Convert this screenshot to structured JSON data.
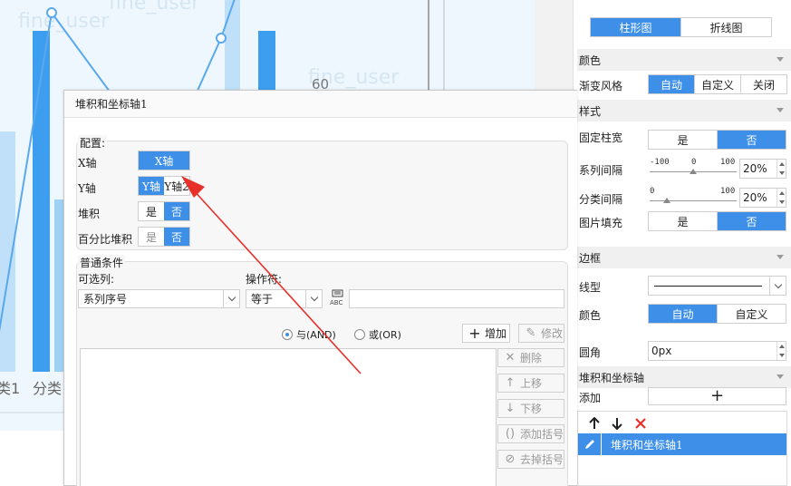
{
  "background_chart": {
    "watermark_texts": [
      "fine_user",
      "fine_user",
      "fine_user"
    ],
    "category_labels": [
      "类1",
      "分类"
    ],
    "axis_tick_label": "60",
    "colors": {
      "bar": "#3d9ef0",
      "bar_light": "#bfe0f8",
      "line": "#5aa8ee",
      "background": "#eef7fd"
    }
  },
  "panel": {
    "chart_type_tabs": [
      {
        "label": "柱形图",
        "active": true
      },
      {
        "label": "折线图",
        "active": false
      }
    ],
    "sections": {
      "color": {
        "title": "颜色"
      },
      "style": {
        "title": "样式"
      },
      "border": {
        "title": "边框"
      },
      "stack": {
        "title": "堆积和坐标轴"
      }
    },
    "gradient_style": {
      "label": "渐变风格",
      "options": [
        {
          "label": "自动",
          "active": true
        },
        {
          "label": "自定义",
          "active": false
        },
        {
          "label": "关闭",
          "active": false
        }
      ]
    },
    "fixed_width": {
      "label": "固定柱宽",
      "options": [
        {
          "label": "是",
          "active": false
        },
        {
          "label": "否",
          "active": true
        }
      ]
    },
    "series_gap": {
      "label": "系列间隔",
      "min": "-100",
      "mid": "0",
      "max": "100",
      "value": "20%",
      "fraction": 0.5
    },
    "category_gap": {
      "label": "分类间隔",
      "min": "0",
      "max": "100",
      "value": "20%",
      "fraction": 0.2
    },
    "image_fill": {
      "label": "图片填充",
      "options": [
        {
          "label": "是",
          "active": false
        },
        {
          "label": "否",
          "active": true
        }
      ]
    },
    "line_type": {
      "label": "线型"
    },
    "border_color": {
      "label": "颜色",
      "options": [
        {
          "label": "自动",
          "active": true
        },
        {
          "label": "自定义",
          "active": false
        }
      ]
    },
    "corner_radius": {
      "label": "圆角",
      "value": "0px"
    },
    "add": {
      "label": "添加",
      "symbol": "+"
    },
    "list_items": [
      {
        "label": "堆积和坐标轴1",
        "selected": true
      }
    ]
  },
  "dialog": {
    "title": "堆积和坐标轴1",
    "config": {
      "legend": "配置:",
      "x_axis": {
        "label": "X轴",
        "options": [
          {
            "label": "X轴",
            "active": true
          }
        ]
      },
      "y_axis": {
        "label": "Y轴",
        "options": [
          {
            "label": "Y轴",
            "active": true
          },
          {
            "label": "Y轴2",
            "active": false
          }
        ]
      },
      "stack": {
        "label": "堆积",
        "options": [
          {
            "label": "是",
            "active": false
          },
          {
            "label": "否",
            "active": true
          }
        ]
      },
      "percent_stack": {
        "label": "百分比堆积",
        "options": [
          {
            "label": "是",
            "active": false
          },
          {
            "label": "否",
            "active": true
          }
        ]
      }
    },
    "conditions": {
      "legend": "普通条件",
      "column_label": "可选列:",
      "column_value": "系列序号",
      "operator_label": "操作符:",
      "operator_value": "等于",
      "value_input": "",
      "logic_and": "与(AND)",
      "logic_or": "或(OR)",
      "logic_selected": "and",
      "add_button": "增加",
      "modify_button": "修改"
    },
    "side_buttons": [
      {
        "label": "删除",
        "icon": "✕"
      },
      {
        "label": "上移",
        "icon": "↑"
      },
      {
        "label": "下移",
        "icon": "↓"
      },
      {
        "label": "添加括号",
        "icon": "()"
      },
      {
        "label": "去掉括号",
        "icon": "⊘"
      }
    ]
  },
  "annotation": {
    "color": "#e8302a"
  }
}
